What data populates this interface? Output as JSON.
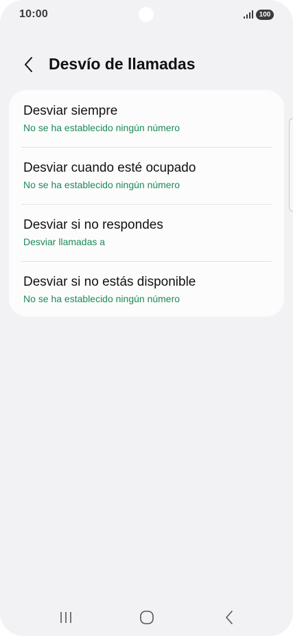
{
  "status_bar": {
    "time": "10:00",
    "battery": "100",
    "signal_icon": "signal-icon"
  },
  "header": {
    "back_icon": "chevron-left-icon",
    "title": "Desvío de llamadas"
  },
  "forwarding_options": [
    {
      "title": "Desviar siempre",
      "subtitle": "No se ha establecido ningún número"
    },
    {
      "title": "Desviar cuando esté ocupado",
      "subtitle": "No se ha establecido ningún número"
    },
    {
      "title": "Desviar si no respondes",
      "subtitle": "Desviar llamadas a"
    },
    {
      "title": "Desviar si no estás disponible",
      "subtitle": "No se ha establecido ningún número"
    }
  ],
  "nav_bar": {
    "recents_icon": "recents-icon",
    "home_icon": "home-icon",
    "back_icon": "back-icon"
  },
  "colors": {
    "background": "#f2f2f4",
    "card": "#fcfcfd",
    "accent_green": "#1a8a55",
    "text": "#111111"
  }
}
